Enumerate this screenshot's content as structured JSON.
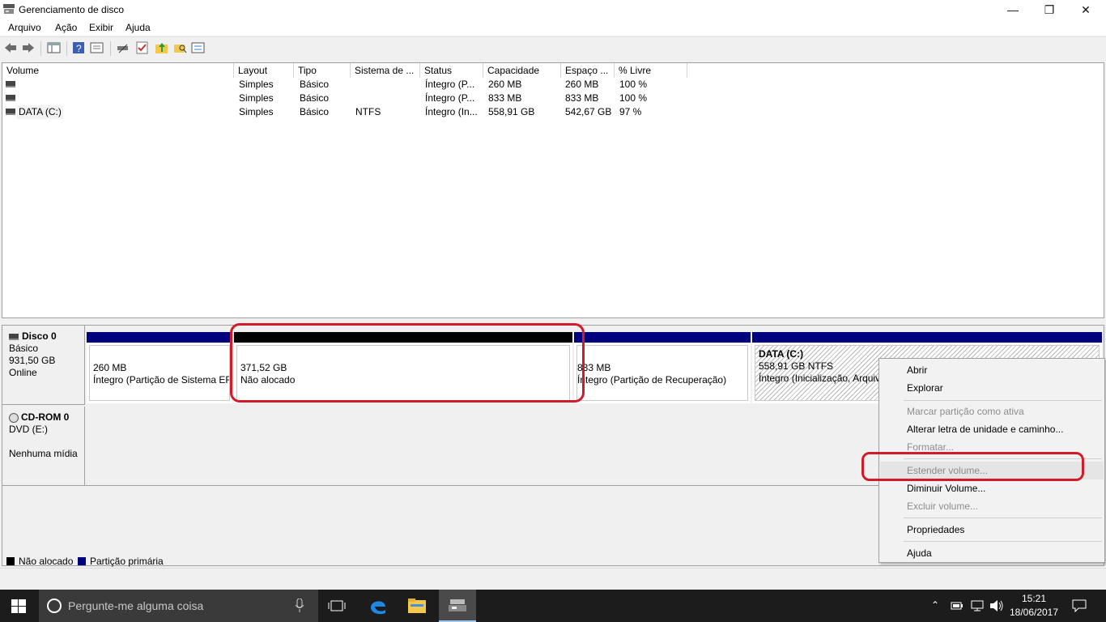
{
  "window": {
    "title": "Gerenciamento de disco",
    "minimize": "—",
    "maximize": "❐",
    "close": "✕"
  },
  "menu": [
    "Arquivo",
    "Ação",
    "Exibir",
    "Ajuda"
  ],
  "volume_table": {
    "columns": [
      "Volume",
      "Layout",
      "Tipo",
      "Sistema de ...",
      "Status",
      "Capacidade",
      "Espaço ...",
      "% Livre"
    ],
    "rows": [
      {
        "volume": "",
        "layout": "Simples",
        "tipo": "Básico",
        "sistema": "",
        "status": "Íntegro (P...",
        "capacidade": "260 MB",
        "espaco": "260 MB",
        "livre": "100 %"
      },
      {
        "volume": "",
        "layout": "Simples",
        "tipo": "Básico",
        "sistema": "",
        "status": "Íntegro (P...",
        "capacidade": "833 MB",
        "espaco": "833 MB",
        "livre": "100 %"
      },
      {
        "volume": "DATA (C:)",
        "layout": "Simples",
        "tipo": "Básico",
        "sistema": "NTFS",
        "status": "Íntegro (In...",
        "capacidade": "558,91 GB",
        "espaco": "542,67 GB",
        "livre": "97 %"
      }
    ]
  },
  "disk0": {
    "name": "Disco 0",
    "type": "Básico",
    "size": "931,50 GB",
    "state": "Online",
    "partitions": [
      {
        "size": "260 MB",
        "desc": "Íntegro (Partição de Sistema EFI"
      },
      {
        "size": "371,52 GB",
        "desc": "Não alocado"
      },
      {
        "size": "833 MB",
        "desc": "Íntegro (Partição de Recuperação)"
      },
      {
        "label": "DATA  (C:)",
        "size": "558,91 GB NTFS",
        "desc": "Íntegro (Inicialização, Arquivo"
      }
    ]
  },
  "cdrom0": {
    "name": "CD-ROM 0",
    "type": "DVD (E:)",
    "state": "Nenhuma mídia"
  },
  "legend": {
    "unallocated": "Não alocado",
    "primary": "Partição primária"
  },
  "context_menu": {
    "abrir": "Abrir",
    "explorar": "Explorar",
    "marcar": "Marcar partição como ativa",
    "alterar": "Alterar letra de unidade e caminho...",
    "formatar": "Formatar...",
    "estender": "Estender volume...",
    "diminuir": "Diminuir Volume...",
    "excluir": "Excluir volume...",
    "propriedades": "Propriedades",
    "ajuda": "Ajuda"
  },
  "taskbar": {
    "search_placeholder": "Pergunte-me alguma coisa",
    "time": "15:21",
    "date": "18/06/2017"
  },
  "colors": {
    "primary_partition": "#00007f",
    "unallocated": "#000000",
    "annotation": "#d01c2a",
    "taskbar": "#1c1c1c"
  }
}
